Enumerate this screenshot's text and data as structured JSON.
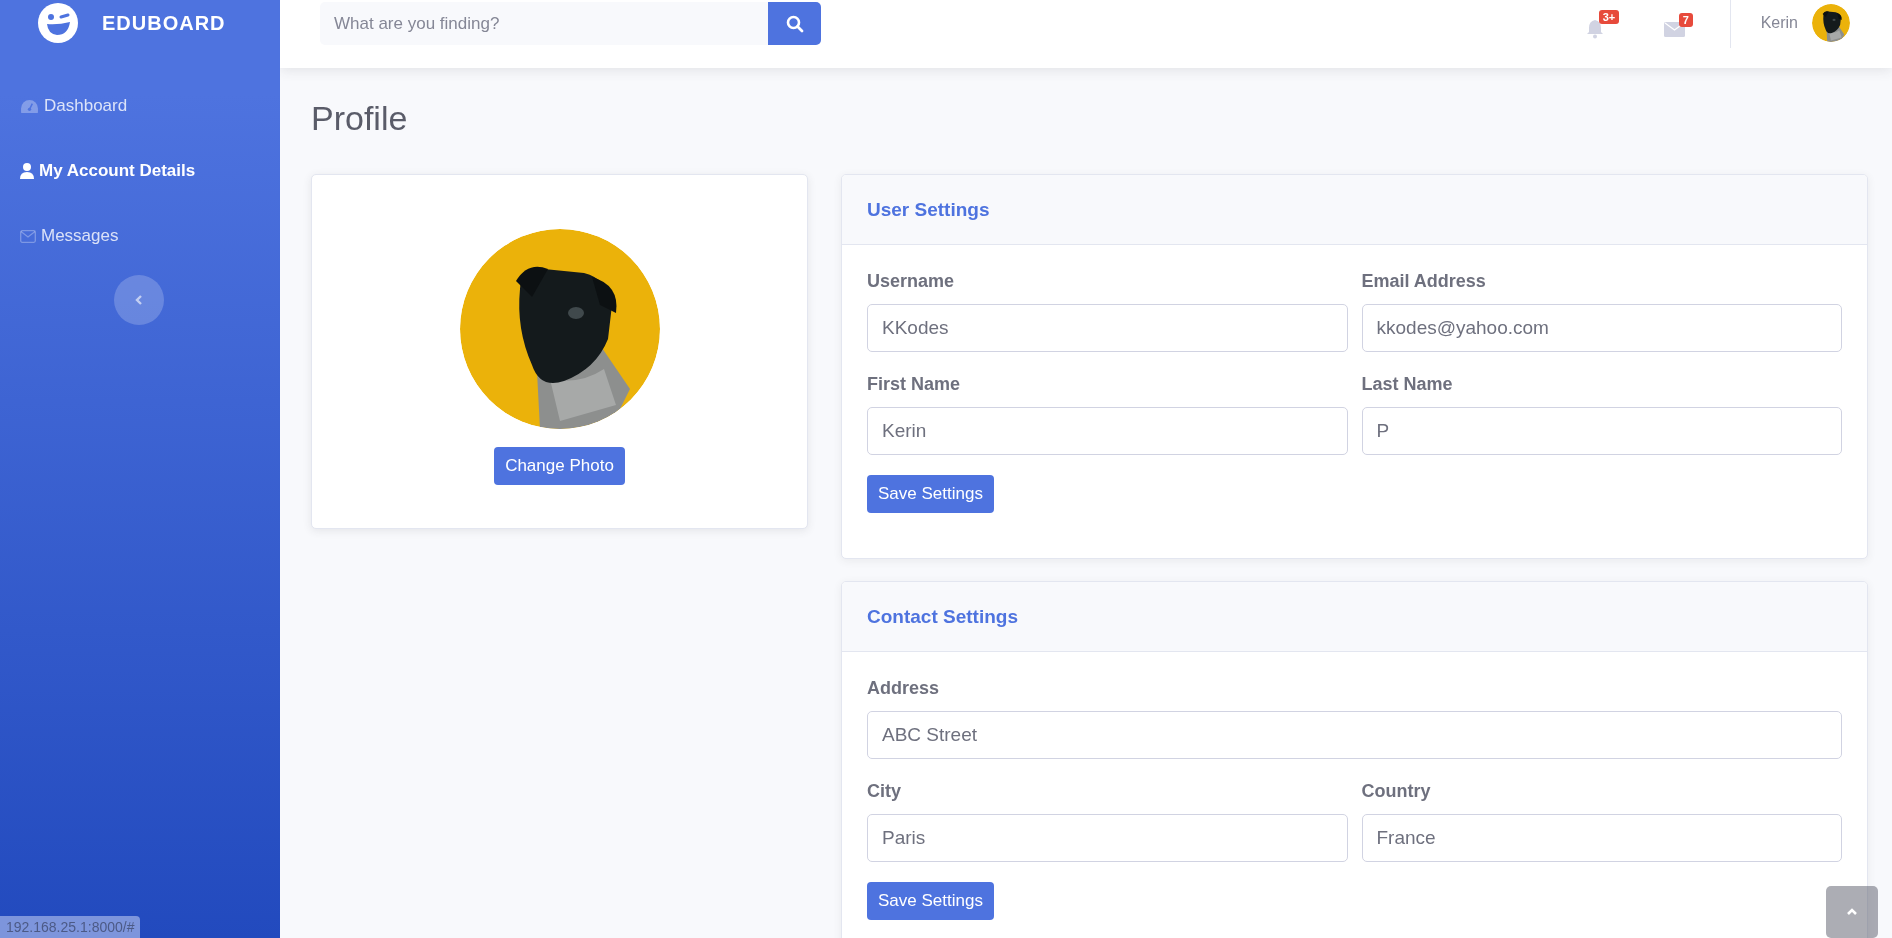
{
  "sidebar": {
    "brand": "EDUBOARD",
    "items": [
      {
        "label": "Dashboard",
        "selected": false
      },
      {
        "label": "My Account Details",
        "selected": true
      },
      {
        "label": "Messages",
        "selected": false
      }
    ]
  },
  "topbar": {
    "search": {
      "placeholder": "What are you finding?"
    },
    "alerts": {
      "count": "3+"
    },
    "messages": {
      "count": "7"
    },
    "user": {
      "name": "Kerin"
    }
  },
  "page_title": "Profile",
  "profile_card": {
    "button": "Change Photo"
  },
  "cards": [
    {
      "title": "User Settings",
      "rows": [
        [
          {
            "label": "Username",
            "value": "KKodes"
          },
          {
            "label": "Email Address",
            "value": "kkodes@yahoo.com"
          }
        ],
        [
          {
            "label": "First Name",
            "value": "Kerin"
          },
          {
            "label": "Last Name",
            "value": "P"
          }
        ]
      ],
      "button": "Save Settings"
    },
    {
      "title": "Contact Settings",
      "rows": [
        [
          {
            "label": "Address",
            "value": "ABC Street"
          }
        ],
        [
          {
            "label": "City",
            "value": "Paris"
          },
          {
            "label": "Country",
            "value": "France"
          }
        ]
      ],
      "button": "Save Settings"
    }
  ],
  "status_url": "192.168.25.1:8000/#"
}
